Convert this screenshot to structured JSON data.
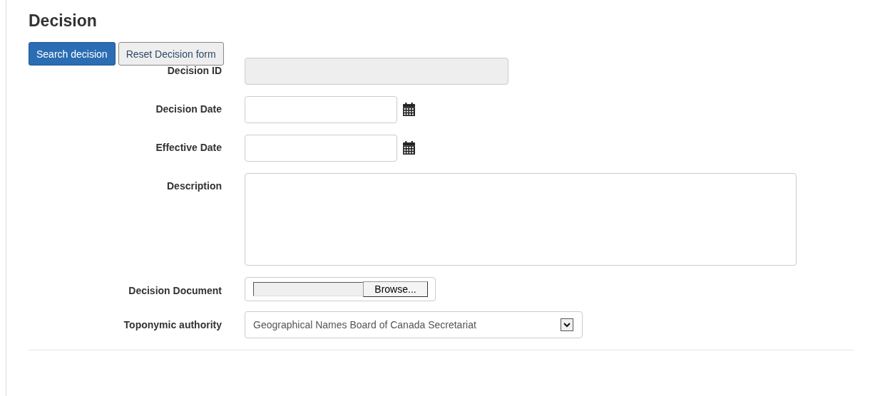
{
  "title": "Decision",
  "buttons": [
    {
      "label": "Search decision",
      "kind": "primary"
    },
    {
      "label": "Reset Decision form",
      "kind": "default"
    }
  ],
  "fields": [
    {
      "label": "Decision ID",
      "kind": "text",
      "disabled": true
    },
    {
      "label": "Decision Date",
      "kind": "date",
      "disabled": false
    },
    {
      "label": "Effective Date",
      "kind": "date",
      "disabled": false
    },
    {
      "label": "Description",
      "kind": "textarea",
      "disabled": false
    },
    {
      "label": "Decision Document",
      "kind": "file",
      "button": "Browse..."
    },
    {
      "label": "Toponymic authority",
      "kind": "select",
      "value": "Geographical Names Board of Canada Secretariat"
    }
  ]
}
